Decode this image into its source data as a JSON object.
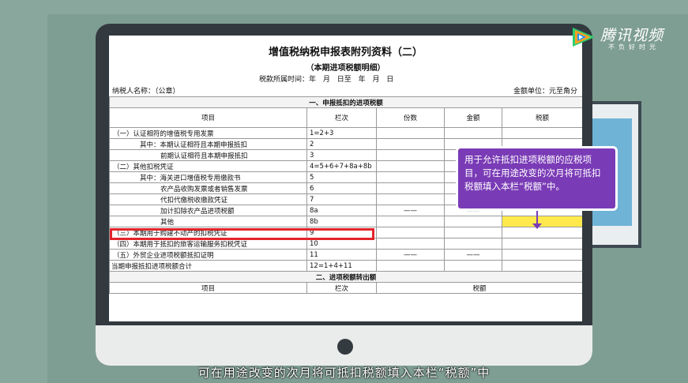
{
  "brand": {
    "name": "腾讯视频",
    "slogan": "不负好时光",
    "colors": {
      "play_green": "#2ecc71",
      "play_orange": "#ff9f1c",
      "play_blue": "#1e90ff"
    }
  },
  "document": {
    "title": "增值税纳税申报表附列资料（二）",
    "subtitle": "（本期进项税额明细）",
    "period_label": "税款所属时间：年 月 日至 年 月 日",
    "taxpayer_label": "纳税人名称：（公章）",
    "unit_label": "金额单位：元至角分",
    "section1_title": "一、申报抵扣的进项税额",
    "section2_title": "二、进项税额转出额",
    "columns": [
      "项目",
      "栏次",
      "份数",
      "金额",
      "税额"
    ],
    "rows": [
      {
        "item": "（一）认证相符的增值税专用发票",
        "code": "1=2+3",
        "fen": "",
        "amt": "",
        "tax": ""
      },
      {
        "item": "其中：本期认证相符且本期申报抵扣",
        "code": "2",
        "fen": "",
        "amt": "",
        "tax": ""
      },
      {
        "item": "前期认证相符且本期申报抵扣",
        "code": "3",
        "fen": "",
        "amt": "",
        "tax": ""
      },
      {
        "item": "（二）其他扣税凭证",
        "code": "4=5+6+7+8a+8b",
        "fen": "",
        "amt": "",
        "tax": ""
      },
      {
        "item": "其中：海关进口增值税专用缴款书",
        "code": "5",
        "fen": "",
        "amt": "",
        "tax": ""
      },
      {
        "item": "农产品收购发票或者销售发票",
        "code": "6",
        "fen": "",
        "amt": "",
        "tax": ""
      },
      {
        "item": "代扣代缴税收缴款凭证",
        "code": "7",
        "fen": "",
        "amt": "",
        "tax": ""
      },
      {
        "item": "加计扣除农产品进项税额",
        "code": "8a",
        "fen": "——",
        "amt": "——",
        "tax": ""
      },
      {
        "item": "其他",
        "code": "8b",
        "fen": "",
        "amt": "",
        "tax": ""
      },
      {
        "item": "（三）本期用于购建不动产的扣税凭证",
        "code": "9",
        "fen": "",
        "amt": "",
        "tax": ""
      },
      {
        "item": "（四）本期用于抵扣的旅客运输服务扣税凭证",
        "code": "10",
        "fen": "",
        "amt": "",
        "tax": ""
      },
      {
        "item": "（五）外贸企业进项税额抵扣证明",
        "code": "11",
        "fen": "——",
        "amt": "——",
        "tax": ""
      },
      {
        "item": "当期申报抵扣进项税额合计",
        "code": "12=1+4+11",
        "fen": "",
        "amt": "",
        "tax": ""
      }
    ],
    "section2_head": [
      "项目",
      "栏次",
      "税额"
    ]
  },
  "callout": {
    "text": "用于允许抵扣进项税额的应税项目，可在用途改变的次月将可抵扣税额填入本栏“税额”中。"
  },
  "caption": "可在用途改变的次月将可抵扣税额填入本栏“税额”中"
}
